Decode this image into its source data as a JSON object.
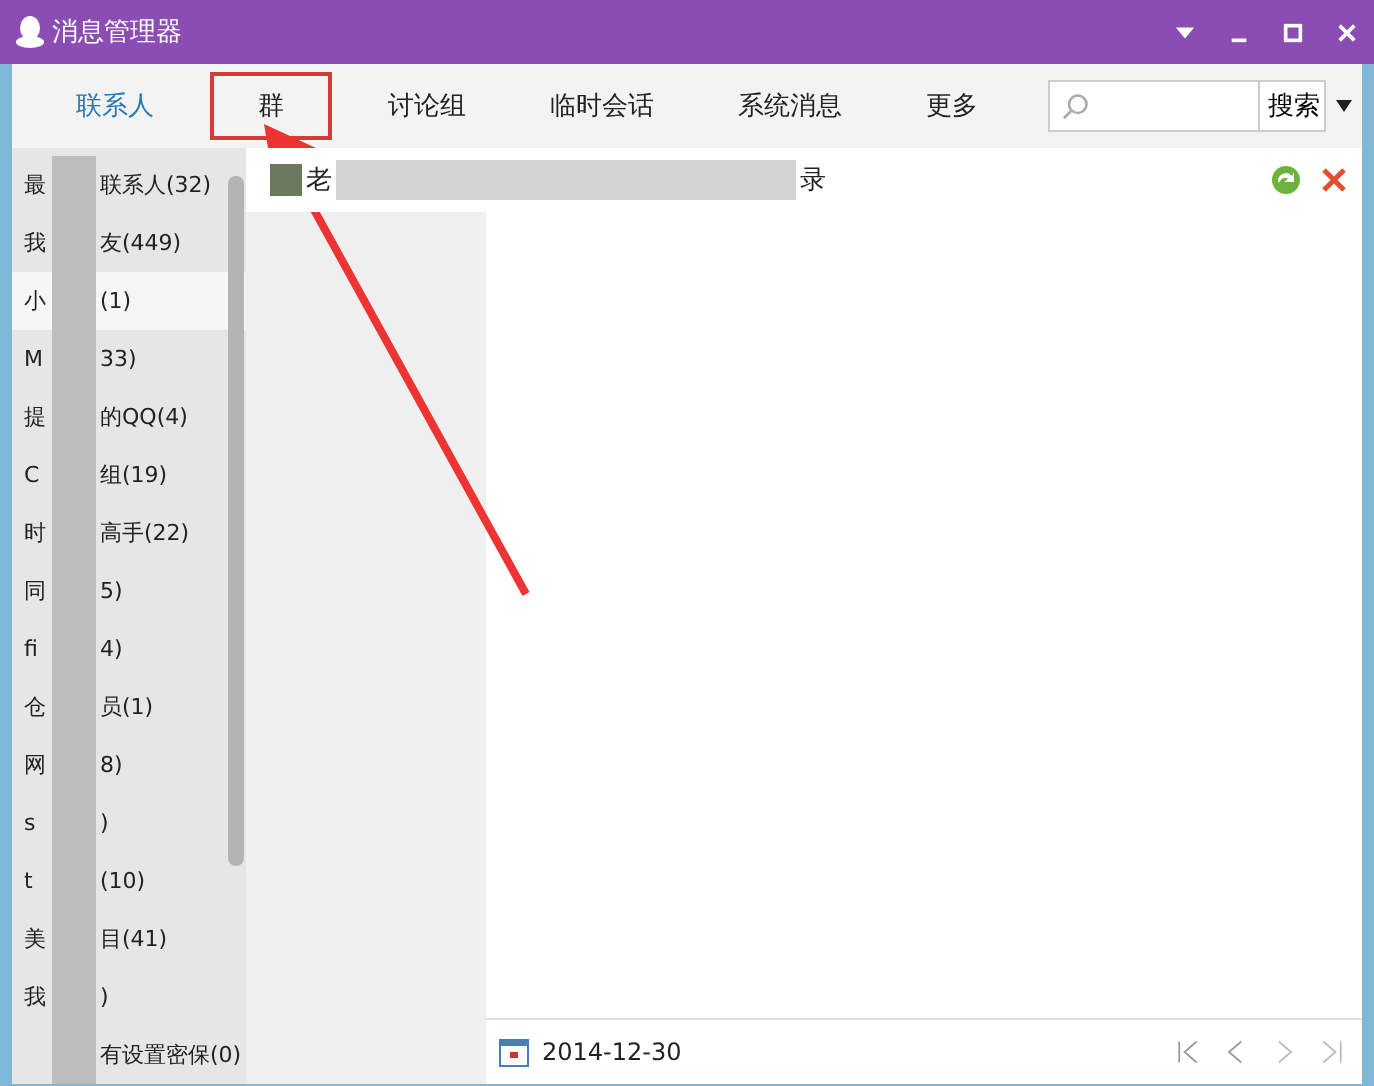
{
  "window": {
    "title": "消息管理器"
  },
  "tabs": [
    {
      "label": "联系人",
      "selected": true,
      "highlighted": false
    },
    {
      "label": "群",
      "selected": false,
      "highlighted": true
    },
    {
      "label": "讨论组",
      "selected": false,
      "highlighted": false
    },
    {
      "label": "临时会话",
      "selected": false,
      "highlighted": false
    },
    {
      "label": "系统消息",
      "selected": false,
      "highlighted": false
    },
    {
      "label": "更多",
      "selected": false,
      "highlighted": false
    }
  ],
  "search": {
    "button": "搜索"
  },
  "sidebar": {
    "items": [
      {
        "prefix": "最",
        "suffix": "联系人(32)",
        "selected": false
      },
      {
        "prefix": "我",
        "suffix": "友(449)",
        "selected": false
      },
      {
        "prefix": "小",
        "suffix": "(1)",
        "selected": true
      },
      {
        "prefix": "M",
        "suffix": "33)",
        "selected": false
      },
      {
        "prefix": "提",
        "suffix": "的QQ(4)",
        "selected": false
      },
      {
        "prefix": "C",
        "suffix": "组(19)",
        "selected": false
      },
      {
        "prefix": "时",
        "suffix": "高手(22)",
        "selected": false
      },
      {
        "prefix": "同",
        "suffix": "5)",
        "selected": false
      },
      {
        "prefix": "fi",
        "suffix": "4)",
        "selected": false
      },
      {
        "prefix": "仓",
        "suffix": "员(1)",
        "selected": false
      },
      {
        "prefix": "网",
        "suffix": "8)",
        "selected": false
      },
      {
        "prefix": "s",
        "suffix": ")",
        "selected": false
      },
      {
        "prefix": "t",
        "suffix": "(10)",
        "selected": false
      },
      {
        "prefix": "美",
        "suffix": "目(41)",
        "selected": false
      },
      {
        "prefix": "我",
        "suffix": ")",
        "selected": false
      },
      {
        "suffix": "有设置密保(0)",
        "selected": false
      }
    ]
  },
  "conversation": {
    "title_start": "老",
    "title_end": "录"
  },
  "footer": {
    "date": "2014-12-30"
  }
}
